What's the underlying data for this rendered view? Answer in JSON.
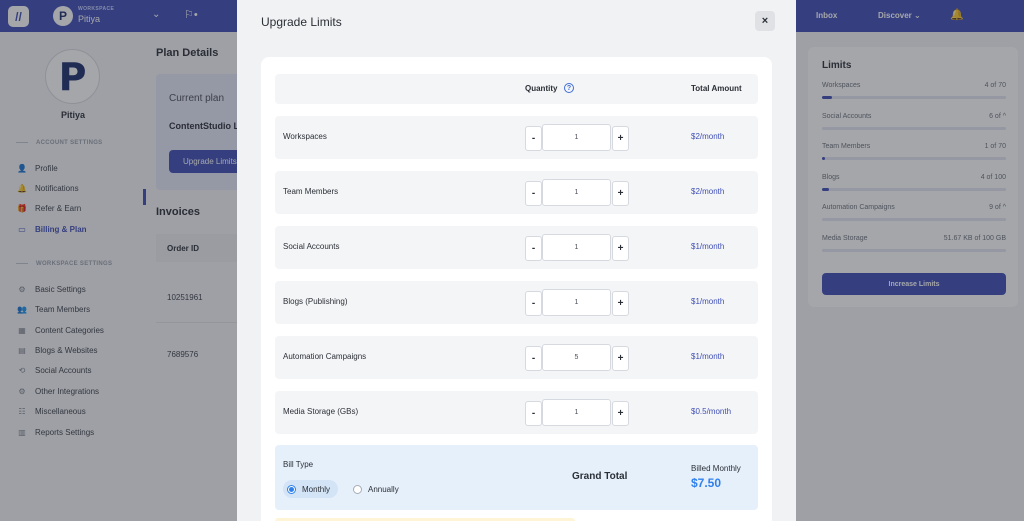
{
  "topbar": {
    "workspace_caption": "WORKSPACE",
    "workspace_name": "Pitiya",
    "avatar_letter": "P",
    "app_logo_glyph": "//",
    "flag_glyph": "⚐•",
    "chevron_glyph": "⌄",
    "nav": {
      "inbox": "Inbox",
      "discover": "Discover ⌄"
    },
    "bell_glyph": "🔔"
  },
  "sidebar": {
    "profile_letter": "P",
    "profile_name": "Pitiya",
    "account_settings": "ACCOUNT SETTINGS",
    "account_items": [
      {
        "label": "Profile",
        "icon": "👤"
      },
      {
        "label": "Notifications",
        "icon": "🔔"
      },
      {
        "label": "Refer & Earn",
        "icon": "🎁"
      },
      {
        "label": "Billing & Plan",
        "icon": "▭"
      }
    ],
    "workspace_settings": "WORKSPACE SETTINGS",
    "workspace_items": [
      {
        "label": "Basic Settings",
        "icon": "⚙"
      },
      {
        "label": "Team Members",
        "icon": "👥"
      },
      {
        "label": "Content Categories",
        "icon": "▦"
      },
      {
        "label": "Blogs & Websites",
        "icon": "▤"
      },
      {
        "label": "Social Accounts",
        "icon": "⟲"
      },
      {
        "label": "Other Integrations",
        "icon": "⚙"
      },
      {
        "label": "Miscellaneous",
        "icon": "☷"
      },
      {
        "label": "Reports Settings",
        "icon": "▥"
      }
    ]
  },
  "main": {
    "title": "Plan Details",
    "current_plan_label": "Current plan",
    "plan_name": "ContentStudio L",
    "upgrade_button": "Upgrade Limits",
    "invoices_title": "Invoices",
    "order_id_header": "Order ID",
    "invoice_rows": [
      "10251961",
      "7689576"
    ]
  },
  "limits": {
    "title": "Limits",
    "rows": [
      {
        "name": "Workspaces",
        "value": "4 of 70",
        "fraction": 0.057
      },
      {
        "name": "Social Accounts",
        "value": "6 of ^",
        "fraction": 0.0
      },
      {
        "name": "Team Members",
        "value": "1 of 70",
        "fraction": 0.014
      },
      {
        "name": "Blogs",
        "value": "4 of 100",
        "fraction": 0.04
      },
      {
        "name": "Automation Campaigns",
        "value": "9 of ^",
        "fraction": 0.0
      },
      {
        "name": "Media Storage",
        "value": "51.67 KB of 100 GB",
        "fraction": 0.0
      }
    ],
    "increase_button": "Increase Limits"
  },
  "modal": {
    "title": "Upgrade Limits",
    "close_glyph": "×",
    "quantity_header": "Quantity",
    "help_glyph": "?",
    "total_header": "Total Amount",
    "minus_glyph": "-",
    "plus_glyph": "+",
    "items": [
      {
        "name": "Workspaces",
        "quantity": "1",
        "price": "$2/month"
      },
      {
        "name": "Team Members",
        "quantity": "1",
        "price": "$2/month"
      },
      {
        "name": "Social Accounts",
        "quantity": "1",
        "price": "$1/month"
      },
      {
        "name": "Blogs (Publishing)",
        "quantity": "1",
        "price": "$1/month"
      },
      {
        "name": "Automation Campaigns",
        "quantity": "5",
        "price": "$1/month"
      },
      {
        "name": "Media Storage (GBs)",
        "quantity": "1",
        "price": "$0.5/month"
      }
    ],
    "bill_type_label": "Bill Type",
    "bill_options": {
      "monthly": "Monthly",
      "annually": "Annually"
    },
    "grand_total_label": "Grand Total",
    "billed_caption": "Billed Monthly",
    "billed_amount": "$7.50"
  }
}
